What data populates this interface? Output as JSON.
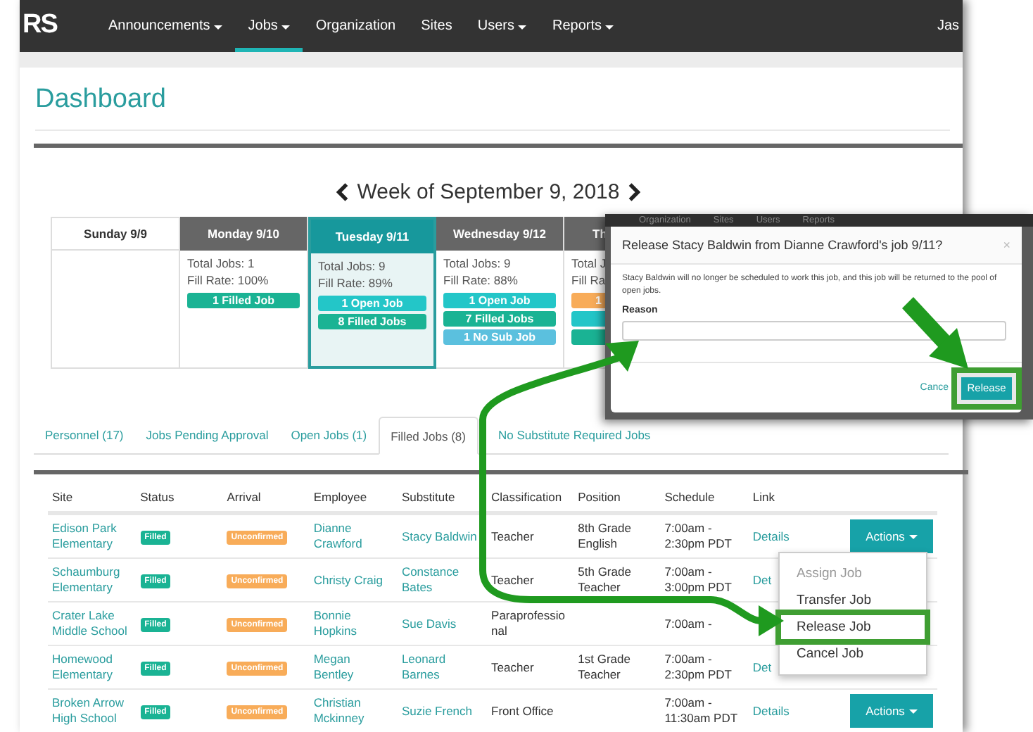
{
  "nav": {
    "logo": "RS",
    "items": [
      {
        "label": "Announcements",
        "caret": true,
        "selected": false
      },
      {
        "label": "Jobs",
        "caret": true,
        "selected": true
      },
      {
        "label": "Organization",
        "caret": false,
        "selected": false
      },
      {
        "label": "Sites",
        "caret": false,
        "selected": false
      },
      {
        "label": "Users",
        "caret": true,
        "selected": false
      },
      {
        "label": "Reports",
        "caret": true,
        "selected": false
      }
    ],
    "user": "Jas"
  },
  "title": "Dashboard",
  "week": {
    "title": "Week of September 9, 2018",
    "days": [
      {
        "label": "Sunday 9/9",
        "selected": false,
        "weekend": true
      },
      {
        "label": "Monday 9/10",
        "selected": false,
        "weekend": false,
        "total": "Total Jobs: 1",
        "fill": "Fill Rate: 100%",
        "jobs": [
          {
            "text": "1 Filled Job",
            "kind": "filled"
          }
        ]
      },
      {
        "label": "Tuesday 9/11",
        "selected": true,
        "weekend": false,
        "total": "Total Jobs: 9",
        "fill": "Fill Rate: 89%",
        "jobs": [
          {
            "text": "1 Open Job",
            "kind": "open"
          },
          {
            "text": "8 Filled Jobs",
            "kind": "filled"
          }
        ]
      },
      {
        "label": "Wednesday 9/12",
        "selected": false,
        "weekend": false,
        "total": "Total Jobs: 9",
        "fill": "Fill Rate: 88%",
        "jobs": [
          {
            "text": "1 Open Job",
            "kind": "open"
          },
          {
            "text": "7 Filled Jobs",
            "kind": "filled"
          },
          {
            "text": "1 No Sub Job",
            "kind": "nosub"
          }
        ]
      },
      {
        "label": "Th",
        "selected": false,
        "weekend": false,
        "total": "Total J",
        "fill": "Fill Ra",
        "jobs": [
          {
            "text": "1",
            "kind": "pending"
          },
          {
            "kind": "open"
          },
          {
            "kind": "filled"
          }
        ]
      }
    ]
  },
  "tabs": [
    {
      "label": "Personnel (17)",
      "selected": false
    },
    {
      "label": "Jobs Pending Approval",
      "selected": false
    },
    {
      "label": "Open Jobs (1)",
      "selected": false
    },
    {
      "label": "Filled Jobs (8)",
      "selected": true
    },
    {
      "label": "No Substitute Required Jobs",
      "selected": false
    }
  ],
  "table": {
    "columns": [
      "Site",
      "Status",
      "Arrival",
      "Employee",
      "Substitute",
      "Classification",
      "Position",
      "Schedule",
      "Link"
    ],
    "rows": [
      {
        "site": "Edison Park Elementary",
        "status": "Filled",
        "arrival": "Unconfirmed",
        "employee": "Dianne Crawford",
        "substitute": "Stacy Baldwin",
        "classification": "Teacher",
        "position": "8th Grade English",
        "schedule": "7:00am - 2:30pm PDT",
        "link": "Details",
        "action": "Actions"
      },
      {
        "site": "Schaumburg Elementary",
        "status": "Filled",
        "arrival": "Unconfirmed",
        "employee": "Christy Craig",
        "substitute": "Constance Bates",
        "classification": "Teacher",
        "position": "5th Grade Teacher",
        "schedule": "7:00am - 3:00pm PDT",
        "link": "Det"
      },
      {
        "site": "Crater Lake Middle School",
        "status": "Filled",
        "arrival": "Unconfirmed",
        "employee": "Bonnie Hopkins",
        "substitute": "Sue Davis",
        "classification": "Paraprofessional",
        "schedule": "7:00am -"
      },
      {
        "site": "Homewood Elementary",
        "status": "Filled",
        "arrival": "Unconfirmed",
        "employee": "Megan Bentley",
        "substitute": "Leonard Barnes",
        "classification": "Teacher",
        "position": "1st Grade Teacher",
        "schedule": "7:00am - 2:30pm PDT",
        "link": "Det"
      },
      {
        "site": "Broken Arrow High School",
        "status": "Filled",
        "arrival": "Unconfirmed",
        "employee": "Christian Mckinney",
        "substitute": "Suzie French",
        "classification": "Front Office",
        "schedule": "7:00am - 11:30am PDT",
        "link": "Details",
        "action": "Actions"
      }
    ]
  },
  "menu": {
    "items": [
      {
        "label": "Assign Job",
        "disabled": true,
        "highlighted": false
      },
      {
        "label": "Transfer Job",
        "disabled": false,
        "highlighted": false
      },
      {
        "label": "Release Job",
        "disabled": false,
        "highlighted": true
      },
      {
        "label": "Cancel Job",
        "disabled": false,
        "highlighted": false
      }
    ]
  },
  "modal": {
    "nav": [
      "Organization",
      "Sites",
      "Users",
      "Reports"
    ],
    "title": "Release Stacy Baldwin from Dianne Crawford's job 9/11?",
    "close": "×",
    "message": "Stacy Baldwin will no longer be scheduled to work this job, and this job will be returned to the pool of open jobs.",
    "reason_label": "Reason",
    "cancel": "Cance",
    "release": "Release"
  }
}
